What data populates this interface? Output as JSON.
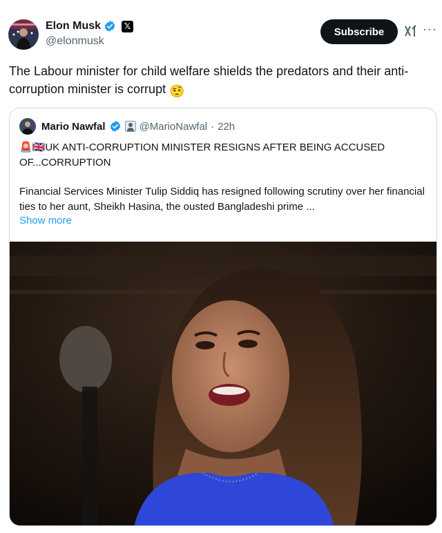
{
  "author": {
    "name": "Elon Musk",
    "handle": "@elonmusk",
    "affiliation_glyph": "𝕏",
    "verified_color": "#1d9bf0"
  },
  "actions": {
    "subscribe_label": "Subscribe",
    "more_glyph": "···",
    "grok_icon": "grok-icon"
  },
  "tweet": {
    "text": "The Labour minister for child welfare shields the predators and their anti-corruption minister is corrupt",
    "emoji": "🤨"
  },
  "quote": {
    "name": "Mario Nawfal",
    "handle": "@MarioNawfal",
    "separator": "·",
    "time": "22h",
    "headline": "🚨🇬🇧UK ANTI-CORRUPTION MINISTER RESIGNS AFTER BEING ACCUSED OF...CORRUPTION",
    "body": "Financial Services Minister Tulip Siddiq has resigned following scrutiny over her financial ties to her aunt, Sheikh Hasina, the ousted Bangladeshi prime ...",
    "show_more": "Show more"
  },
  "colors": {
    "text": "#0f1419",
    "secondary": "#536471",
    "link": "#1d9bf0",
    "border": "#cfd9de",
    "button_bg": "#0f1419"
  }
}
